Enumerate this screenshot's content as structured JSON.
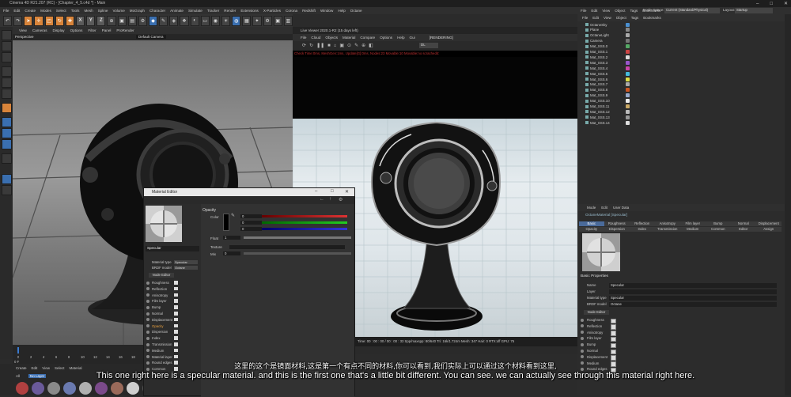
{
  "window": {
    "title": "Cinema 4D R21.207 (RC) - [Chapter_4_5.c4d *] - Main"
  },
  "menubar": [
    "File",
    "Edit",
    "Create",
    "Modes",
    "Select",
    "Tools",
    "Mesh",
    "Spline",
    "Volume",
    "MoGraph",
    "Character",
    "Animate",
    "Simulate",
    "Tracker",
    "Render",
    "Extensions",
    "X-Particles",
    "Corona",
    "Redshift",
    "Window",
    "Help",
    "Octane"
  ],
  "toolbar": {
    "xyz": [
      "X",
      "Y",
      "Z"
    ]
  },
  "viewport": {
    "menu": [
      "View",
      "Cameras",
      "Display",
      "Options",
      "Filter",
      "Panel",
      "ProRender"
    ],
    "projection": "Perspective",
    "camera": "Default Camera"
  },
  "timeline": {
    "ticks": [
      "0",
      "2",
      "4",
      "6",
      "8",
      "10",
      "12",
      "14",
      "16",
      "18",
      "20"
    ],
    "frame_field": "0 F"
  },
  "material_manager": {
    "menu": [
      "Create",
      "Edit",
      "View",
      "Select",
      "Material"
    ],
    "layer_label": "All",
    "no_layer_label": "No Layer"
  },
  "live_viewer": {
    "title": "Live Viewer 2020.1-R2 (15 days left)",
    "menu": [
      "File",
      "Cloud",
      "Objects",
      "Material",
      "Compare",
      "Options",
      "Help",
      "Gui"
    ],
    "render_badge": "[RENDERING]",
    "mode": "DL",
    "status": "Check Time:0ms, MeshGen:1ms, Update[G]:0ms, Nodes:23 Movable:10 Movable:no scrachedit:",
    "bottom_status": "Time: 00 : 00 : 00 / 00 : 00 : 33  Spp/maxspp: 80/640  Tri: 16k/1.724m  Mesh: 347  Hair: 0  RTX:off  GPU: 75",
    "bottom_left": "NTER"
  },
  "object_manager": {
    "menu": [
      "File",
      "Edit",
      "View",
      "Object",
      "Tags",
      "Bookmarks"
    ],
    "node_space_label": "Node Space:",
    "node_space_value": "Current (Standard/Physical)",
    "layout_label": "Layout:",
    "layout_value": "Startup",
    "submenu": [
      "File",
      "Edit",
      "View",
      "Object",
      "Tags",
      "Bookmarks"
    ],
    "objects": [
      "OctaneSky",
      "Plane",
      "OctaneLight",
      "Camera",
      "Mat_SSS.0",
      "Mat_SSS.1",
      "Mat_SSS.2",
      "Mat_SSS.3",
      "Mat_SSS.4",
      "Mat_SSS.5",
      "Mat_SSS.6",
      "Mat_SSS.7",
      "Mat_SSS.8",
      "Mat_SSS.9",
      "Mat_SSS.10",
      "Mat_SSS.11",
      "Mat_SSS.12",
      "Mat_SSS.13",
      "Mat_SSS.14"
    ],
    "tag_colors": [
      "#4a8fd0",
      "#888888",
      "#aaaaaa",
      "#777777",
      "#55aa66",
      "#cc4444",
      "#dddddd",
      "#9955cc",
      "#cc44aa",
      "#44bbdd",
      "#dddd44",
      "#aaaaaa",
      "#cc5522",
      "#99aacc",
      "#eeeeee",
      "#ccaa66",
      "#bbbbbb",
      "#999999",
      "#dddddd"
    ]
  },
  "attributes": {
    "menu": [
      "Mode",
      "Edit",
      "User Data"
    ],
    "title": "OctaneMaterial [Specular]",
    "tabs_row1": [
      "Basic",
      "Roughness",
      "Reflection",
      "Anisotropy",
      "Film layer",
      "Bump",
      "Normal",
      "Displacement"
    ],
    "tabs_row2": [
      "Opacity",
      "Dispersion",
      "Index",
      "Transmission",
      "Medium",
      "Common",
      "Editor",
      "Assign"
    ],
    "section": "Basic Properties",
    "name_label": "Name",
    "name_value": "Specular",
    "layer_label": "Layer",
    "mtype_label": "Material type",
    "mtype_value": "Specular",
    "brdf_label": "BRDF model",
    "brdf_value": "Octane",
    "node_editor_label": "Node Editor",
    "channels": [
      "Roughness",
      "Reflection",
      "Anisotropy",
      "Film layer",
      "Bump",
      "Normal",
      "Displacement",
      "Medium",
      "Round edges"
    ]
  },
  "material_editor": {
    "title": "Material Editor",
    "name": "Specular",
    "mtype_label": "Material type",
    "mtype_value": "Specular",
    "brdf_label": "BRDF model",
    "brdf_value": "Octane",
    "node_editor_label": "Node Editor",
    "channels": [
      "Roughness",
      "Reflection",
      "Anisotropy",
      "Film layer",
      "Bump",
      "Normal",
      "Displacement",
      "Opacity",
      "Dispersion",
      "Index",
      "Transmission",
      "Medium",
      "Material layer",
      "Round edges",
      "Common"
    ],
    "selected_channel": "Opacity",
    "section": "Opacity",
    "color_label": "Color",
    "rgb_values": [
      "1",
      "0",
      "0",
      "0"
    ],
    "float_label": "Float",
    "float_value": "1",
    "texture_label": "Texture",
    "mix_label": "Mix",
    "mix_value": "0"
  },
  "subtitles": {
    "cn": "这里的这个是镜面材料,这是第一个有点不同的材料,你可以看到,我们实际上可以通过这个材料看到这里,",
    "en": "This one right here is a specular material. and this is the first one that's a little bit different. You can see. we can actually see through this material right here."
  }
}
